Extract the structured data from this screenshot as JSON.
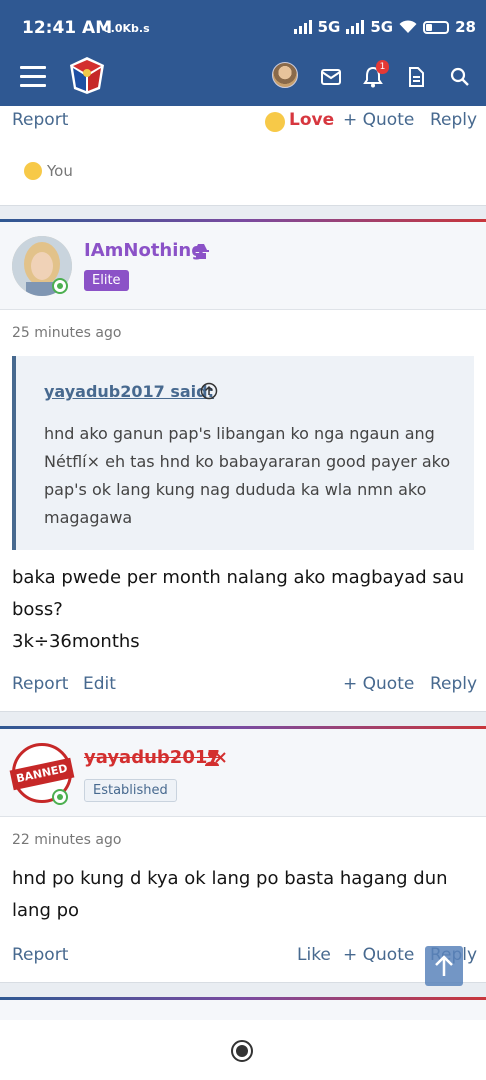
{
  "status_bar": {
    "time": "12:41 AM",
    "speed": "0.0Kb.s",
    "net1": "5G",
    "net2": "5G",
    "battery": "28"
  },
  "app_header": {
    "notification_count": "1",
    "brand_color": "#2f5892"
  },
  "post_top": {
    "report": "Report",
    "reaction_label": "Love",
    "quote": "+ Quote",
    "reply": "Reply",
    "reacted_by": "You"
  },
  "post_1": {
    "username": "IAmNothing",
    "rank": "Elite",
    "time": "25 minutes ago",
    "quote_author": "yayadub2017 said:",
    "quote_text": "hnd ako ganun pap's libangan ko nga ngaun ang Nétflí× eh tas hnd ko babayararan good payer ako pap's ok lang kung nag dududa ka wla nmn ako magagawa",
    "message_line1": "baka pwede per month nalang ako magbayad sau boss?",
    "message_line2": "3k÷36months",
    "report": "Report",
    "edit": "Edit",
    "quote": "+ Quote",
    "reply": "Reply"
  },
  "post_2": {
    "username": "yayadub2017",
    "rank": "Established",
    "avatar_label": "BANNED",
    "time": "22 minutes ago",
    "message": "hnd po kung d kya ok lang po basta hagang dun lang po",
    "report": "Report",
    "like": "Like",
    "quote": "+ Quote",
    "reply": "Reply"
  }
}
